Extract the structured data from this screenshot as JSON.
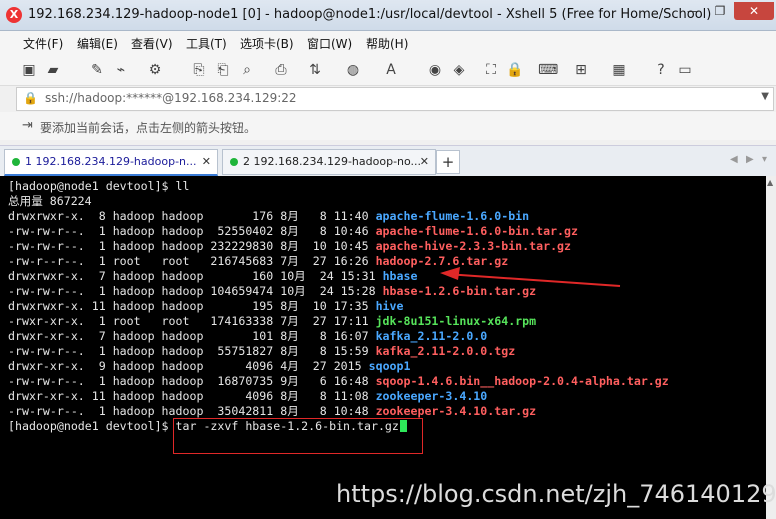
{
  "window": {
    "title": "192.168.234.129-hadoop-node1 [0] - hadoop@node1:/usr/local/devtool - Xshell 5 (Free for Home/School)",
    "minimize": "—",
    "maximize": "❐",
    "close": "✕"
  },
  "menu": [
    "文件(F)",
    "编辑(E)",
    "查看(V)",
    "工具(T)",
    "选项卡(B)",
    "窗口(W)",
    "帮助(H)"
  ],
  "address": {
    "value": "ssh://hadoop:******@192.168.234.129:22"
  },
  "hint": "要添加当前会话，点击左侧的箭头按钮。",
  "tabs": [
    {
      "label": "1 192.168.234.129-hadoop-n...",
      "active": true
    },
    {
      "label": "2 192.168.234.129-hadoop-no...",
      "active": false
    }
  ],
  "terminal": {
    "prompt_cmd": "[hadoop@node1 devtool]$ ll",
    "total": "总用量 867224",
    "rows": [
      {
        "meta": "drwxrwxr-x.  8 hadoop hadoop       176 8月   8 11:40 ",
        "name": "apache-flume-1.6.0-bin",
        "kind": "dir"
      },
      {
        "meta": "-rw-rw-r--.  1 hadoop hadoop  52550402 8月   8 10:46 ",
        "name": "apache-flume-1.6.0-bin.tar.gz",
        "kind": "arch"
      },
      {
        "meta": "-rw-rw-r--.  1 hadoop hadoop 232229830 8月  10 10:45 ",
        "name": "apache-hive-2.3.3-bin.tar.gz",
        "kind": "arch"
      },
      {
        "meta": "-rw-r--r--.  1 root   root   216745683 7月  27 16:26 ",
        "name": "hadoop-2.7.6.tar.gz",
        "kind": "arch"
      },
      {
        "meta": "drwxrwxr-x.  7 hadoop hadoop       160 10月  24 15:31 ",
        "name": "hbase",
        "kind": "dir"
      },
      {
        "meta": "-rw-rw-r--.  1 hadoop hadoop 104659474 10月  24 15:28 ",
        "name": "hbase-1.2.6-bin.tar.gz",
        "kind": "arch"
      },
      {
        "meta": "drwxrwxr-x. 11 hadoop hadoop       195 8月  10 17:35 ",
        "name": "hive",
        "kind": "dir"
      },
      {
        "meta": "-rwxr-xr-x.  1 root   root   174163338 7月  27 17:11 ",
        "name": "jdk-8u151-linux-x64.rpm",
        "kind": "exec"
      },
      {
        "meta": "drwxr-xr-x.  7 hadoop hadoop       101 8月   8 16:07 ",
        "name": "kafka_2.11-2.0.0",
        "kind": "dir"
      },
      {
        "meta": "-rw-rw-r--.  1 hadoop hadoop  55751827 8月   8 15:59 ",
        "name": "kafka_2.11-2.0.0.tgz",
        "kind": "arch"
      },
      {
        "meta": "drwxr-xr-x.  9 hadoop hadoop      4096 4月  27 2015 ",
        "name": "sqoop1",
        "kind": "dir"
      },
      {
        "meta": "-rw-rw-r--.  1 hadoop hadoop  16870735 9月   6 16:48 ",
        "name": "sqoop-1.4.6.bin__hadoop-2.0.4-alpha.tar.gz",
        "kind": "arch"
      },
      {
        "meta": "drwxr-xr-x. 11 hadoop hadoop      4096 8月   8 11:08 ",
        "name": "zookeeper-3.4.10",
        "kind": "dir"
      },
      {
        "meta": "-rw-rw-r--.  1 hadoop hadoop  35042811 8月   8 10:48 ",
        "name": "zookeeper-3.4.10.tar.gz",
        "kind": "arch"
      }
    ],
    "prompt_final": "[hadoop@node1 devtool]$ ",
    "typed_command": "tar -zxvf hbase-1.2.6-bin.tar.gz"
  },
  "watermark": "https://blog.csdn.net/zjh_746140129",
  "colors": {
    "dir": "#4aa8ff",
    "arch": "#ff5f5f",
    "exec": "#56e35a",
    "annotation": "#e02828"
  }
}
